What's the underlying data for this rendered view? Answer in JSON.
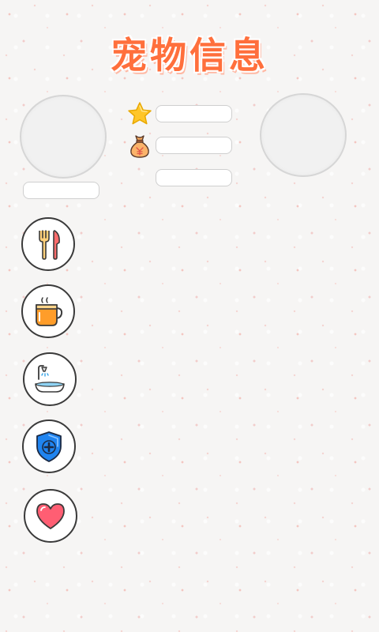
{
  "header": {
    "title": "宠物信息"
  },
  "pet": {
    "name": "",
    "stat_star": "",
    "stat_money": "",
    "stat_third": ""
  },
  "icons": {
    "star": "star-icon",
    "money": "money-bag-icon",
    "feed": "fork-knife-icon",
    "drink": "cup-icon",
    "bath": "shower-basin-icon",
    "medicine": "medical-shield-icon",
    "love": "heart-icon"
  },
  "colors": {
    "title": "#ff6f3c",
    "star": "#ffc628",
    "heart": "#ff5e73",
    "shield": "#1f84f0",
    "cup": "#ff9d2a"
  }
}
